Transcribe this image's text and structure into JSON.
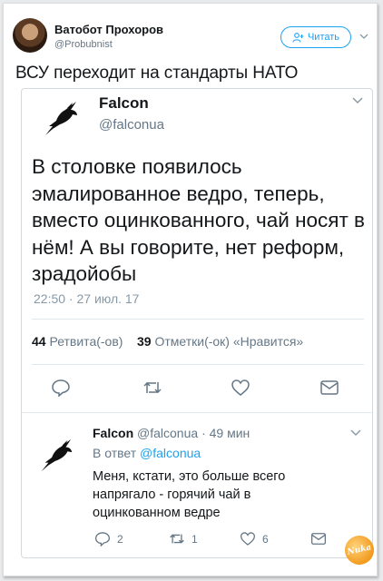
{
  "header": {
    "author_name": "Ватобот Прохоров",
    "author_handle": "@Probubnist",
    "follow_label": "Читать"
  },
  "tweet": {
    "text": "ВСУ переходит на стандарты НАТО"
  },
  "quoted": {
    "name": "Falcon",
    "handle": "@falconua",
    "text": "В столовке появилось эмалированное ведро, теперь, вместо оцинкованного, чай носят в нём! А вы говорите, нет реформ, зрадойобы",
    "timestamp": "22:50 · 27 июл. 17",
    "retweets_count": "44",
    "retweets_label": "Ретвита(-ов)",
    "likes_count": "39",
    "likes_label": "Отметки(-ок) «Нравится»"
  },
  "reply": {
    "name": "Falcon",
    "handle": "@falconua",
    "separator": "·",
    "time": "49 мин",
    "in_reply_prefix": "В ответ",
    "in_reply_handle": "@falconua",
    "text": "Меня, кстати, это больше всего напрягало - горячий чай в оцинкованном ведре",
    "reply_count": "2",
    "retweet_count": "1",
    "like_count": "6"
  },
  "watermark": {
    "text": "Nuka"
  },
  "colors": {
    "accent": "#1da1f2",
    "muted": "#657786",
    "text": "#14171a"
  },
  "icons": [
    "avatar",
    "follow-user-icon",
    "chevron-down-icon",
    "raven-avatar-icon",
    "reply-icon",
    "retweet-icon",
    "like-icon",
    "direct-message-icon"
  ]
}
